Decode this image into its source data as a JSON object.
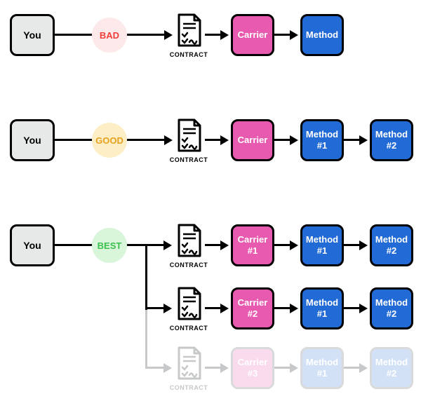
{
  "colors": {
    "you_bg": "#e7e9e9",
    "carrier_bg": "#e85aaf",
    "method_bg": "#226ad6",
    "bad_fg": "#ee3f3c",
    "bad_bg": "#fde9e9",
    "good_fg": "#e6a21f",
    "good_bg": "#fdeec6",
    "best_fg": "#3bbf4d",
    "best_bg": "#d9f6db",
    "faded_line": "#c6c8ca"
  },
  "labels": {
    "you": "You",
    "contract": "CONTRACT"
  },
  "rows": {
    "bad": {
      "badge": "BAD",
      "items": [
        "Carrier",
        "Method"
      ]
    },
    "good": {
      "badge": "GOOD",
      "items": [
        "Carrier",
        "Method #1",
        "Method #2"
      ]
    },
    "best": {
      "badge": "BEST",
      "branches": [
        {
          "faded": false,
          "items": [
            "Carrier #1",
            "Method #1",
            "Method #2"
          ]
        },
        {
          "faded": false,
          "items": [
            "Carrier #2",
            "Method #1",
            "Method #2"
          ]
        },
        {
          "faded": true,
          "items": [
            "Carrier #3",
            "Method #1",
            "Method #2"
          ]
        }
      ]
    }
  }
}
